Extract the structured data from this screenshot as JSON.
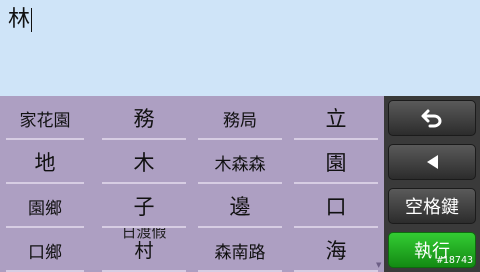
{
  "input": {
    "value": "林"
  },
  "candidates": [
    "家花園",
    "務",
    "務局",
    "立",
    "地",
    "木",
    "木森森",
    "園",
    "園鄉",
    "子",
    "邊",
    "口",
    "口鄉",
    "日渡假村",
    "森南路",
    "海"
  ],
  "candidate_13": {
    "line1": "日渡假",
    "line2": "村"
  },
  "controls": {
    "backspace_icon": "undo-arrow-icon",
    "cursor_left_icon": "triangle-left-icon",
    "space_label": "空格鍵",
    "execute_label": "執行",
    "badge": "#18743"
  },
  "colors": {
    "input_bg": "#cfe4f8",
    "candidate_bg": "#ad9fc2",
    "button_dark": "#3a3a3a",
    "button_green": "#22aa22"
  }
}
